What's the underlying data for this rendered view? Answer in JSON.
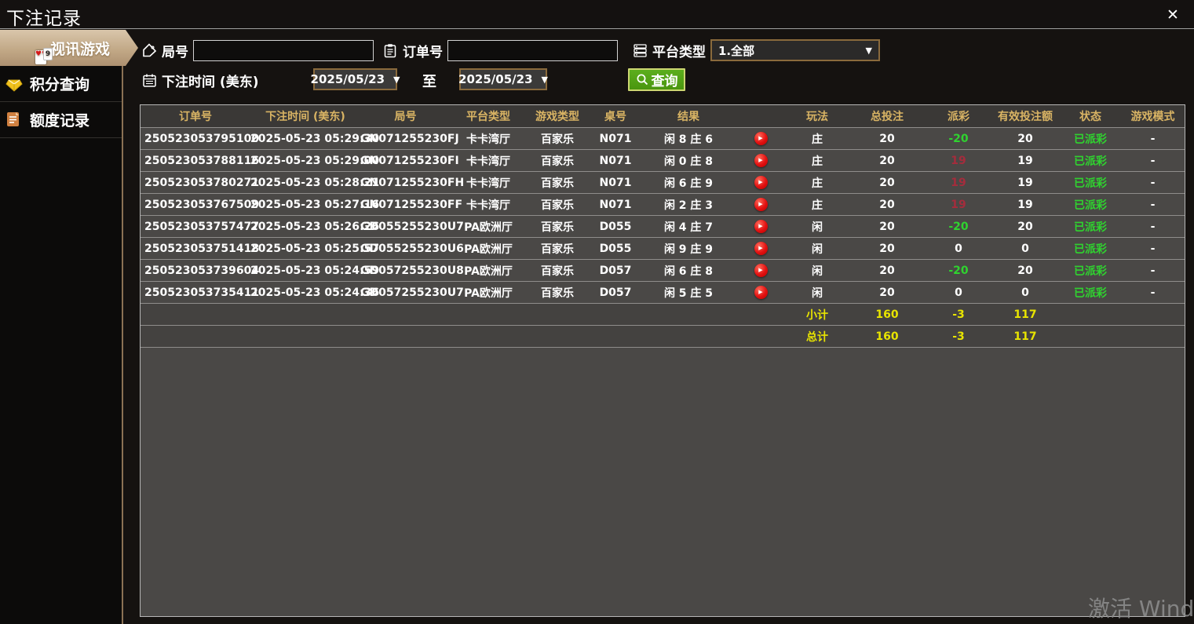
{
  "window": {
    "title": "下注记录"
  },
  "ui": {
    "close": "✕",
    "dropdown_arrow": "▼",
    "play_glyph": "▶"
  },
  "sidebar": {
    "items": [
      {
        "label": "视讯游戏",
        "icon": "playing-cards-icon",
        "selected": true,
        "card_badge": "9",
        "card_suits": "♥♥"
      },
      {
        "label": "积分查询",
        "icon": "diamond-icon",
        "selected": false
      },
      {
        "label": "额度记录",
        "icon": "document-icon",
        "selected": false
      }
    ]
  },
  "filters": {
    "round": {
      "label": "局号",
      "value": "",
      "icon": "tag-icon"
    },
    "order": {
      "label": "订单号",
      "value": "",
      "icon": "clipboard-icon"
    },
    "platform": {
      "label": "平台类型",
      "value": "1.全部",
      "icon": "server-list-icon"
    },
    "time": {
      "label": "下注时间 (美东)",
      "from": "2025/05/23",
      "to_label": "至",
      "to": "2025/05/23",
      "icon": "calendar-icon"
    },
    "search": {
      "label": "查询",
      "icon": "magnifier-icon"
    }
  },
  "table": {
    "columns": [
      "订单号",
      "下注时间 (美东)",
      "局号",
      "平台类型",
      "游戏类型",
      "桌号",
      "结果",
      "",
      "玩法",
      "总投注",
      "派彩",
      "有效投注额",
      "状态",
      "游戏模式"
    ],
    "rows": [
      {
        "order_no": "250523053795100",
        "bet_time": "2025-05-23 05:29:30",
        "round_no": "GN071255230FJ",
        "platform": "卡卡湾厅",
        "game_type": "百家乐",
        "table_no": "N071",
        "result": "闲 8 庄 6",
        "bet_type": "庄",
        "total_bet": "20",
        "payout": "-20",
        "payout_color": "green",
        "valid_bet": "20",
        "status": "已派彩",
        "game_mode": "-"
      },
      {
        "order_no": "250523053788116",
        "bet_time": "2025-05-23 05:29:00",
        "round_no": "GN071255230FI",
        "platform": "卡卡湾厅",
        "game_type": "百家乐",
        "table_no": "N071",
        "result": "闲 0 庄 8",
        "bet_type": "庄",
        "total_bet": "20",
        "payout": "19",
        "payout_color": "red",
        "valid_bet": "19",
        "status": "已派彩",
        "game_mode": "-"
      },
      {
        "order_no": "250523053780271",
        "bet_time": "2025-05-23 05:28:21",
        "round_no": "GN071255230FH",
        "platform": "卡卡湾厅",
        "game_type": "百家乐",
        "table_no": "N071",
        "result": "闲 6 庄 9",
        "bet_type": "庄",
        "total_bet": "20",
        "payout": "19",
        "payout_color": "red",
        "valid_bet": "19",
        "status": "已派彩",
        "game_mode": "-"
      },
      {
        "order_no": "250523053767509",
        "bet_time": "2025-05-23 05:27:16",
        "round_no": "GN071255230FF",
        "platform": "卡卡湾厅",
        "game_type": "百家乐",
        "table_no": "N071",
        "result": "闲 2 庄 3",
        "bet_type": "庄",
        "total_bet": "20",
        "payout": "19",
        "payout_color": "red",
        "valid_bet": "19",
        "status": "已派彩",
        "game_mode": "-"
      },
      {
        "order_no": "250523053757477",
        "bet_time": "2025-05-23 05:26:26",
        "round_no": "GD055255230U7",
        "platform": "PA欧洲厅",
        "game_type": "百家乐",
        "table_no": "D055",
        "result": "闲 4 庄 7",
        "bet_type": "闲",
        "total_bet": "20",
        "payout": "-20",
        "payout_color": "green",
        "valid_bet": "20",
        "status": "已派彩",
        "game_mode": "-"
      },
      {
        "order_no": "250523053751418",
        "bet_time": "2025-05-23 05:25:57",
        "round_no": "GD055255230U6",
        "platform": "PA欧洲厅",
        "game_type": "百家乐",
        "table_no": "D055",
        "result": "闲 9 庄 9",
        "bet_type": "闲",
        "total_bet": "20",
        "payout": "0",
        "payout_color": "white",
        "valid_bet": "0",
        "status": "已派彩",
        "game_mode": "-"
      },
      {
        "order_no": "250523053739604",
        "bet_time": "2025-05-23 05:24:59",
        "round_no": "GD057255230U8",
        "platform": "PA欧洲厅",
        "game_type": "百家乐",
        "table_no": "D057",
        "result": "闲 6 庄 8",
        "bet_type": "闲",
        "total_bet": "20",
        "payout": "-20",
        "payout_color": "green",
        "valid_bet": "20",
        "status": "已派彩",
        "game_mode": "-"
      },
      {
        "order_no": "250523053735411",
        "bet_time": "2025-05-23 05:24:36",
        "round_no": "GD057255230U7",
        "platform": "PA欧洲厅",
        "game_type": "百家乐",
        "table_no": "D057",
        "result": "闲 5 庄 5",
        "bet_type": "闲",
        "total_bet": "20",
        "payout": "0",
        "payout_color": "white",
        "valid_bet": "0",
        "status": "已派彩",
        "game_mode": "-"
      }
    ],
    "summary": [
      {
        "label": "小计",
        "total_bet": "160",
        "payout": "-3",
        "valid_bet": "117"
      },
      {
        "label": "总计",
        "total_bet": "160",
        "payout": "-3",
        "valid_bet": "117"
      }
    ]
  },
  "watermark": "激活 Windows",
  "colors": {
    "accent_tan": "#c2a987",
    "win_red": "#a52c3c",
    "lose_green": "#2fd32f",
    "summary_yellow": "#e8e400",
    "header_gold": "#d9b464",
    "button_green": "#4a960f"
  }
}
